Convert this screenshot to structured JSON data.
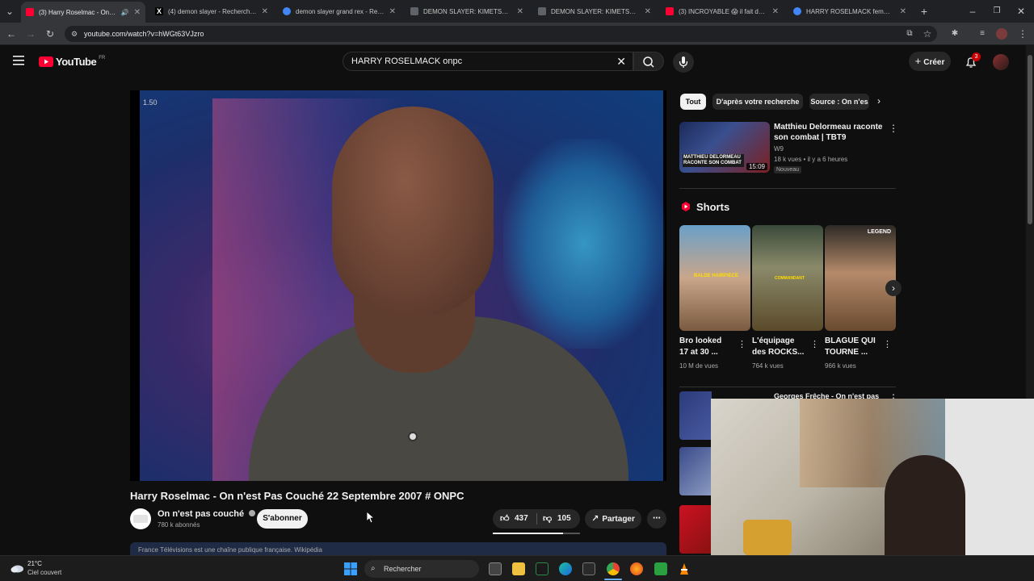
{
  "browser": {
    "tabs": [
      {
        "title": "(3) Harry Roselmac - On n'e",
        "active": true,
        "favicon_color": "#ff0033"
      },
      {
        "title": "(4) demon slayer - Recherche /",
        "active": false,
        "favicon_color": "#e8eaed"
      },
      {
        "title": "demon slayer grand rex - Reche",
        "active": false,
        "favicon_color": "#4285f4"
      },
      {
        "title": "DEMON SLAYER: KIMETSU NO",
        "active": false,
        "favicon_color": "#9aa0a6"
      },
      {
        "title": "DEMON SLAYER: KIMETSU NO",
        "active": false,
        "favicon_color": "#9aa0a6"
      },
      {
        "title": "(3) INCROYABLE 😱 il fait des r",
        "active": false,
        "favicon_color": "#ff0033"
      },
      {
        "title": "HARRY ROSELMACK femme - F",
        "active": false,
        "favicon_color": "#4285f4"
      }
    ],
    "url": "youtube.com/watch?v=hWGt63VJzro"
  },
  "masthead": {
    "logo_text": "YouTube",
    "region": "FR",
    "search_value": "HARRY ROSELMACK onpc",
    "create_label": "Créer",
    "notification_count": "3"
  },
  "player": {
    "overlay_text": "1.50"
  },
  "video": {
    "title": "Harry Roselmac - On n'est Pas Couché 22 Septembre 2007 # ONPC",
    "channel_name": "On n'est pas couché",
    "subscribers": "780 k abonnés",
    "subscribe_label": "S'abonner",
    "likes": "437",
    "dislikes": "105",
    "share_label": "Partager",
    "description_preview": "France Télévisions est une chaîne publique française. Wikipédia"
  },
  "sidebar": {
    "chips": [
      "Tout",
      "D'après votre recherche",
      "Source : On n'es"
    ],
    "recommended": [
      {
        "title_line1": "Matthieu Delormeau raconte",
        "title_line2": "son combat | TBT9",
        "channel": "W9",
        "meta": "18 k vues • il y a 6 heures",
        "badge": "Nouveau",
        "duration": "15:09",
        "thumb_caption": "MATTHIEU DELORMEAU RACONTE SON COMBAT"
      },
      {
        "title_line1": "Georges Frêche - On n'est pas",
        "channel": "",
        "meta": "",
        "duration": ""
      }
    ],
    "shorts_heading": "Shorts",
    "shorts": [
      {
        "title_line1": "Bro looked",
        "title_line2": "17 at 30 ...",
        "views": "10 M de vues",
        "thumb_caption": "BALDE HAIRPIECE"
      },
      {
        "title_line1": "L'équipage",
        "title_line2": "des ROCKS...",
        "views": "764 k vues",
        "thumb_caption": "COMMANDANT"
      },
      {
        "title_line1": "BLAGUE QUI",
        "title_line2": "TOURNE ...",
        "views": "966 k vues",
        "thumb_caption": "LEGEND"
      }
    ]
  },
  "taskbar": {
    "weather_temp": "21°C",
    "weather_desc": "Ciel couvert",
    "search_placeholder": "Rechercher"
  },
  "colors": {
    "yt_red": "#ff0033",
    "background": "#0f0f0f",
    "chip_bg": "#272727"
  }
}
